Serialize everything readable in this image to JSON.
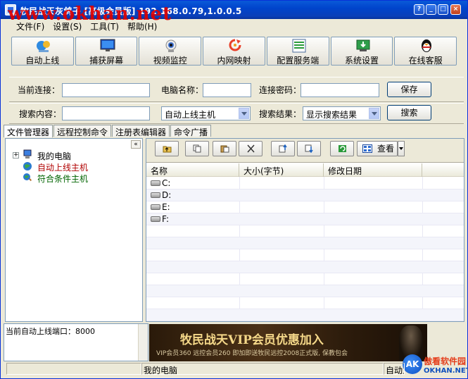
{
  "window": {
    "title": "牧民战天灰鸽子 [高级会员版]  192.168.0.79,1.0.0.5",
    "watermark": "www.okhan.net"
  },
  "menu": [
    "文件(F)",
    "设置(S)",
    "工具(T)",
    "帮助(H)"
  ],
  "toolbar": [
    {
      "label": "自动上线",
      "icon": "auto-online-icon"
    },
    {
      "label": "捕获屏幕",
      "icon": "monitor-icon"
    },
    {
      "label": "视频监控",
      "icon": "camera-icon"
    },
    {
      "label": "内网映射",
      "icon": "network-map-icon"
    },
    {
      "label": "配置服务端",
      "icon": "config-server-icon"
    },
    {
      "label": "系统设置",
      "icon": "system-settings-icon"
    },
    {
      "label": "在线客服",
      "icon": "penguin-icon"
    }
  ],
  "connection": {
    "current_label": "当前连接：",
    "current_value": "",
    "pcname_label": "电脑名称：",
    "pcname_value": "",
    "password_label": "连接密码：",
    "password_value": "",
    "save_label": "保存"
  },
  "search": {
    "content_label": "搜索内容：",
    "content_value": "",
    "scope_value": "自动上线主机",
    "result_label": "搜索结果：",
    "result_value": "显示搜索结果",
    "search_label": "搜索"
  },
  "tabs": [
    "文件管理器",
    "远程控制命令",
    "注册表编辑器",
    "命令广播"
  ],
  "tree": {
    "collapse_glyph": "«",
    "items": [
      {
        "label": "我的电脑",
        "expander": "+"
      },
      {
        "label": "自动上线主机"
      },
      {
        "label": "符合条件主机"
      }
    ]
  },
  "file_toolbar": {
    "view_label": "查看"
  },
  "file_list": {
    "columns": [
      "名称",
      "大小(字节)",
      "修改日期"
    ],
    "rows": [
      {
        "name": "C:"
      },
      {
        "name": "D:"
      },
      {
        "name": "E:"
      },
      {
        "name": "F:"
      }
    ]
  },
  "log": {
    "text": "当前自动上线端口：8000"
  },
  "banner": {
    "title": "牧民战天VIP会员优惠加入",
    "subtitle": "VIP会员360 远控会员260 即加即送牧民远控2008正式版, 保教包会"
  },
  "logo": {
    "mark": "AK",
    "cn": "傲看软件园",
    "en": "OKHAN.NET"
  },
  "status": {
    "cell1": "",
    "cell2": "我的电脑",
    "cell3": "自动上"
  },
  "colors": {
    "titlebar": "#0a4fd1",
    "tree_auto": "#b00000",
    "tree_match": "#006400",
    "watermark": "#e00000"
  }
}
